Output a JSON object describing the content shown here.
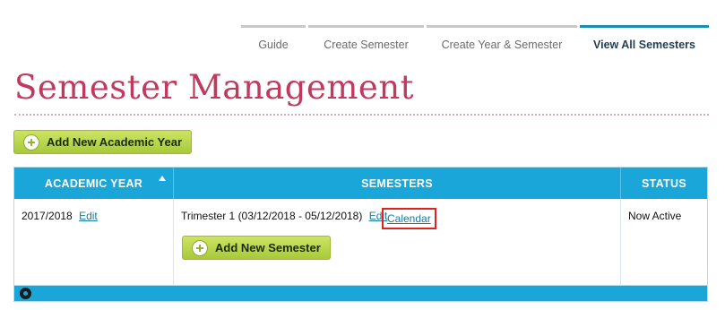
{
  "tabs": [
    {
      "label": "Guide"
    },
    {
      "label": "Create Semester"
    },
    {
      "label": "Create Year & Semester"
    },
    {
      "label": "View All Semesters",
      "active": true
    }
  ],
  "page": {
    "title": "Semester Management"
  },
  "actions": {
    "add_year_label": "Add New Academic Year"
  },
  "table": {
    "headers": {
      "year": "ACADEMIC YEAR",
      "semesters": "SEMESTERS",
      "status": "STATUS"
    },
    "rows": [
      {
        "year": "2017/2018",
        "year_edit": "Edit",
        "semester": "Trimester 1 (03/12/2018 - 05/12/2018)",
        "semester_edit": "Edit",
        "calendar": "Calendar",
        "add_semester_label": "Add New Semester",
        "status": "Now Active"
      }
    ]
  },
  "icons": {
    "plus": "plus-circle-icon",
    "sort": "sort-asc-icon",
    "gear": "gear-icon"
  },
  "colors": {
    "accent_blue": "#1aa6d8",
    "title_pink": "#c0395e",
    "button_green": "#b3d145",
    "highlight_red": "#e0221c"
  }
}
